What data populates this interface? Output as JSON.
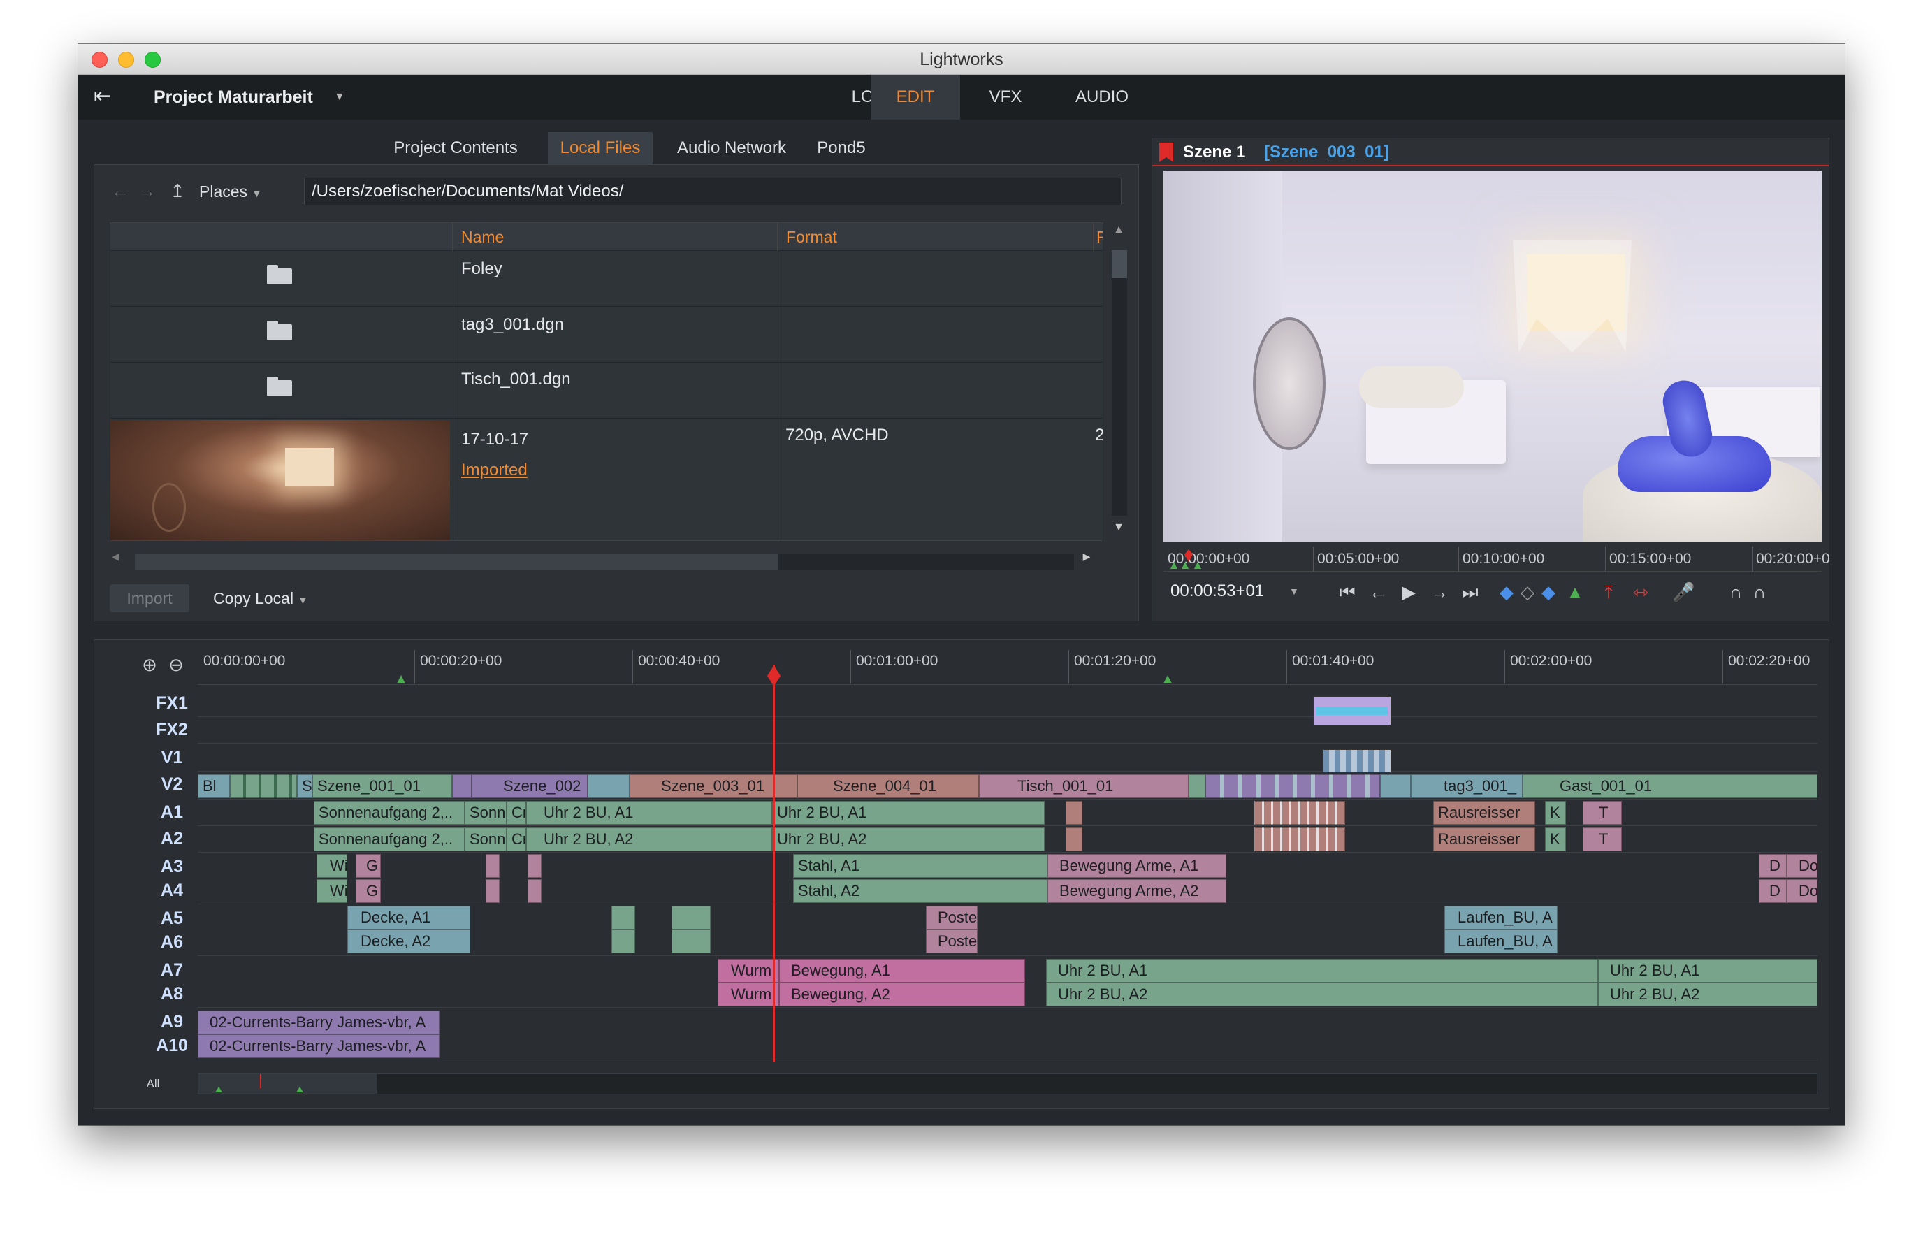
{
  "window": {
    "title": "Lightworks"
  },
  "project": {
    "name": "Project Maturarbeit"
  },
  "main_tabs": [
    {
      "label": "LOG"
    },
    {
      "label": "EDIT",
      "active": true
    },
    {
      "label": "VFX"
    },
    {
      "label": "AUDIO"
    }
  ],
  "browser": {
    "tabs": [
      "Project Contents",
      "Local Files",
      "Audio Network",
      "Pond5"
    ],
    "active_tab": "Local Files",
    "places_label": "Places",
    "path": "/Users/zoefischer/Documents/Mat Videos/",
    "columns": [
      "Name",
      "Format",
      "F"
    ],
    "rows": [
      {
        "name": "Foley",
        "type": "folder"
      },
      {
        "name": "tag3_001.dgn",
        "type": "folder"
      },
      {
        "name": "Tisch_001.dgn",
        "type": "folder"
      },
      {
        "name": "17-10-17",
        "status": "Imported",
        "format": "720p, AVCHD",
        "extra": "2"
      }
    ],
    "import_label": "Import",
    "copy_local_label": "Copy Local"
  },
  "viewer": {
    "title": "Szene 1",
    "clip": "[Szene_003_01]",
    "timecode": "00:00:53+01",
    "ruler": [
      "00:00:00+00",
      "00:05:00+00",
      "00:10:00+00",
      "00:15:00+00",
      "00:20:00+0"
    ]
  },
  "timeline": {
    "ruler": [
      "00:00:00+00",
      "00:00:20+00",
      "00:00:40+00",
      "00:01:00+00",
      "00:01:20+00",
      "00:01:40+00",
      "00:02:00+00",
      "00:02:20+00"
    ],
    "tracks": [
      "FX1",
      "FX2",
      "V1",
      "V2",
      "A1",
      "A2",
      "A3",
      "A4",
      "A5",
      "A6",
      "A7",
      "A8",
      "A9",
      "A10"
    ],
    "all_label": "All",
    "clips": {
      "v2": [
        "Bl",
        "Sz",
        "Szene_001_01",
        "Szene_002",
        "Szene_003_01",
        "Szene_004_01",
        "Tisch_001_01",
        "tag3_001_",
        "Gast_001_01"
      ],
      "a1": [
        "Sonnenaufgang 2,..",
        "Sonn",
        "Cr",
        "Uhr 2 BU, A1",
        "Uhr 2 BU, A1",
        "Rausreisser",
        "K",
        "T"
      ],
      "a2": [
        "Sonnenaufgang 2,..",
        "Sonn",
        "Cr",
        "Uhr 2 BU, A2",
        "Uhr 2 BU, A2",
        "Rausreisser",
        "K",
        "T"
      ],
      "a3": [
        "Wi",
        "G",
        "Stahl, A1",
        "Bewegung Arme, A1",
        "D",
        "Do"
      ],
      "a4": [
        "Wi",
        "G",
        "Stahl, A2",
        "Bewegung Arme, A2",
        "D",
        "Do"
      ],
      "a5": [
        "Decke, A1",
        "Poster ab",
        "Laufen_BU, A"
      ],
      "a6": [
        "Decke, A2",
        "Poster ab",
        "Laufen_BU, A"
      ],
      "a7": [
        "Wurm",
        "Bewegung, A1",
        "Uhr 2 BU, A1",
        "Uhr 2 BU, A1"
      ],
      "a8": [
        "Wurm",
        "Bewegung, A2",
        "Uhr 2 BU, A2",
        "Uhr 2 BU, A2"
      ],
      "a9": [
        "02-Currents-Barry James-vbr, A"
      ],
      "a10": [
        "02-Currents-Barry James-vbr, A"
      ]
    }
  }
}
